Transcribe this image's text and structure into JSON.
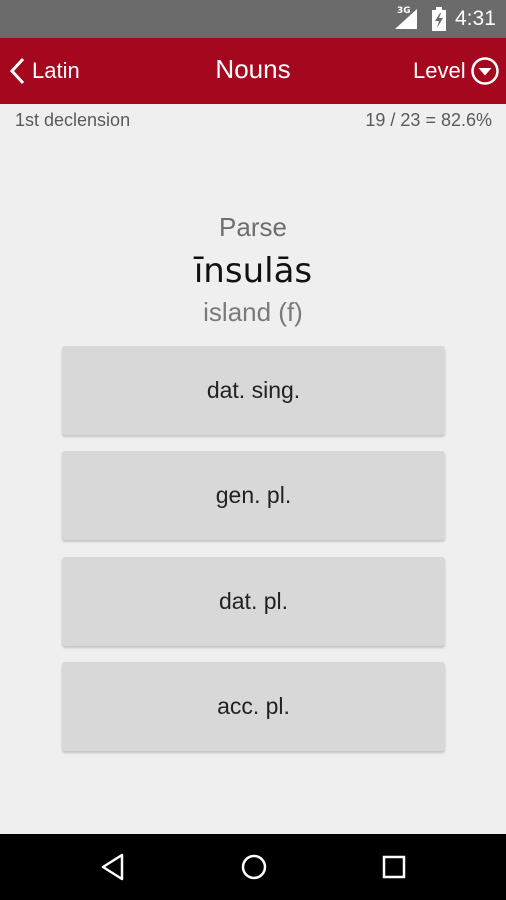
{
  "status_bar": {
    "network": "3G",
    "time": "4:31",
    "icons": [
      "signal-icon",
      "battery-icon"
    ]
  },
  "app_bar": {
    "back_label": "Latin",
    "title": "Nouns",
    "level_label": "Level",
    "background_color": "#a5081e",
    "icons": [
      "chevron-left-icon",
      "dropdown-circle-icon"
    ]
  },
  "sub_header": {
    "left": "1st declension",
    "right": "19 / 23 = 82.6%"
  },
  "question": {
    "prompt": "Parse",
    "word": "īnsulās",
    "gloss": "island (f)"
  },
  "answers": [
    {
      "label": "dat. sing."
    },
    {
      "label": "gen. pl."
    },
    {
      "label": "dat. pl."
    },
    {
      "label": "acc. pl."
    }
  ],
  "nav_bar": {
    "icons": [
      "back-triangle-icon",
      "home-circle-icon",
      "recents-square-icon"
    ]
  }
}
